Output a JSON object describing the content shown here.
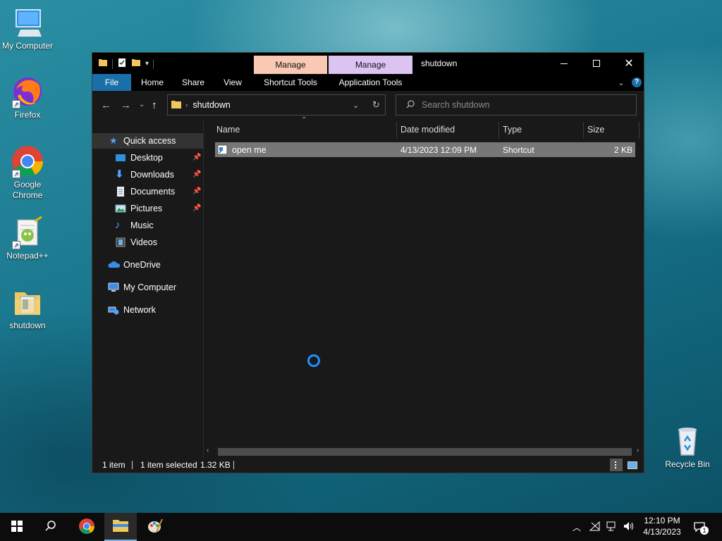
{
  "desktop": {
    "icons": [
      {
        "label": "My Computer"
      },
      {
        "label": "Firefox"
      },
      {
        "label": "Google Chrome"
      },
      {
        "label": "Notepad++"
      },
      {
        "label": "shutdown"
      },
      {
        "label": "Recycle Bin"
      }
    ]
  },
  "window": {
    "title": "shutdown",
    "context_tabs": [
      {
        "label": "Manage",
        "color": "#f9c9b4"
      },
      {
        "label": "Manage",
        "color": "#dcc4f2"
      }
    ],
    "ribbon_tabs": {
      "file": "File",
      "home": "Home",
      "share": "Share",
      "view": "View",
      "shortcut_tools": "Shortcut Tools",
      "application_tools": "Application Tools"
    },
    "address": {
      "path": "shutdown"
    },
    "search": {
      "placeholder": "Search shutdown"
    },
    "nav": {
      "quick_access": "Quick access",
      "desktop": "Desktop",
      "downloads": "Downloads",
      "documents": "Documents",
      "pictures": "Pictures",
      "music": "Music",
      "videos": "Videos",
      "onedrive": "OneDrive",
      "my_computer": "My Computer",
      "network": "Network"
    },
    "columns": {
      "name": "Name",
      "date_modified": "Date modified",
      "type": "Type",
      "size": "Size"
    },
    "files": [
      {
        "name": "open me",
        "date": "4/13/2023 12:09 PM",
        "type": "Shortcut",
        "size": "2 KB"
      }
    ],
    "status": {
      "count": "1 item",
      "selected": "1 item selected",
      "size": "1.32 KB"
    }
  },
  "taskbar": {
    "time": "12:10 PM",
    "date": "4/13/2023",
    "notifications": "1"
  },
  "colors": {
    "accent": "#1a6fa8",
    "selection": "#777777",
    "spinner": "#1e90ff"
  }
}
